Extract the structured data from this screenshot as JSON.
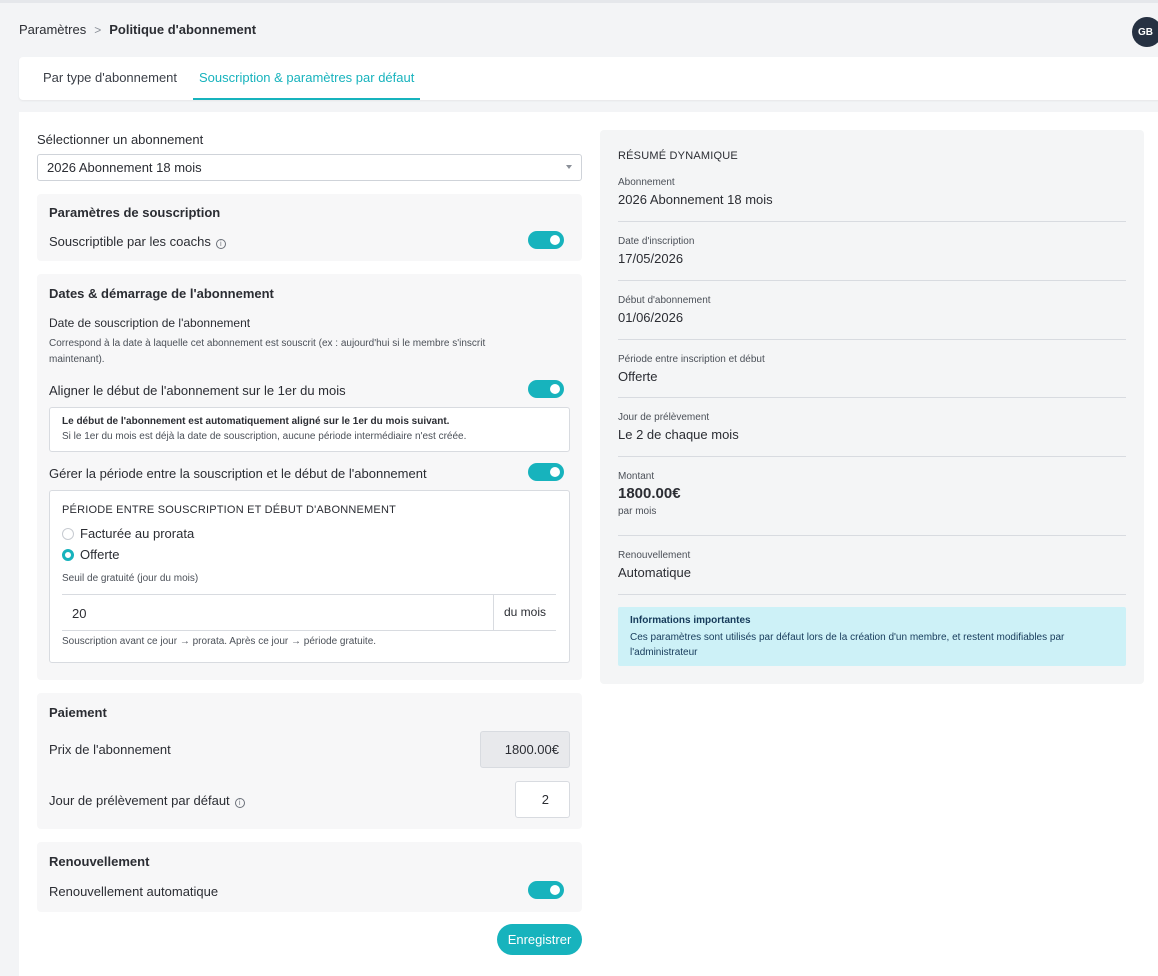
{
  "breadcrumb": {
    "root": "Paramètres",
    "separator": ">",
    "current": "Politique d'abonnement"
  },
  "user": {
    "initials": "GB"
  },
  "tabs": [
    {
      "label": "Par type d'abonnement",
      "active": false
    },
    {
      "label": "Souscription & paramètres par défaut",
      "active": true
    }
  ],
  "select": {
    "label": "Sélectionner un abonnement",
    "value": "2026 Abonnement 18 mois"
  },
  "souscription": {
    "title": "Paramètres de souscription",
    "coachs_label": "Souscriptible par les coachs",
    "coachs_enabled": true
  },
  "dates": {
    "title": "Dates & démarrage de l'abonnement",
    "date_label": "Date de souscription de l'abonnement",
    "date_help_line1": "Correspond à la date à laquelle cet abonnement est souscrit (ex : aujourd'hui si le membre s'inscrit",
    "date_help_line2": "maintenant).",
    "align_label": "Aligner le début de l'abonnement sur le 1er du mois",
    "align_enabled": true,
    "notice_bold": "Le début de l'abonnement est automatiquement aligné sur le 1er du mois suivant.",
    "notice_text": "Si le 1er du mois est déjà la date de souscription, aucune période intermédiaire n'est créée.",
    "period_label": "Gérer la période entre la souscription et le début de l'abonnement",
    "period_enabled": true,
    "period_box": {
      "title": "PÉRIODE ENTRE SOUSCRIPTION ET DÉBUT D'ABONNEMENT",
      "options": [
        {
          "label": "Facturée au prorata",
          "checked": false
        },
        {
          "label": "Offerte",
          "checked": true
        }
      ],
      "seuil_label": "Seuil de gratuité (jour du mois)",
      "seuil_value": "20",
      "seuil_unit": "du mois",
      "seuil_hint": "Souscription avant ce jour → prorata. Après ce jour → période gratuite."
    }
  },
  "paiement": {
    "title": "Paiement",
    "price_label": "Prix de l'abonnement",
    "price_value": "1800.00€",
    "day_label": "Jour de prélèvement par défaut",
    "day_value": "2"
  },
  "renouvellement": {
    "title": "Renouvellement",
    "auto_label": "Renouvellement automatique",
    "auto_enabled": true
  },
  "save_label": "Enregistrer",
  "summary": {
    "title": "RÉSUMÉ DYNAMIQUE",
    "items": [
      {
        "key": "Abonnement",
        "value": "2026 Abonnement 18 mois"
      },
      {
        "key": "Date d'inscription",
        "value": "17/05/2026"
      },
      {
        "key": "Début d'abonnement",
        "value": "01/06/2026"
      },
      {
        "key": "Période entre inscription et début",
        "value": "Offerte"
      },
      {
        "key": "Jour de prélèvement",
        "value": "Le 2 de chaque mois"
      },
      {
        "key": "Montant",
        "value": "1800.00€",
        "sub": "par mois"
      },
      {
        "key": "Renouvellement",
        "value": "Automatique"
      }
    ],
    "important_title": "Informations importantes",
    "important_text": "Ces paramètres sont utilisés par défaut lors de la création d'un membre, et restent modifiables par l'administrateur"
  },
  "colors": {
    "accent": "#17b3bd",
    "info_bg": "#cdf1f7",
    "avatar": "#263142"
  }
}
